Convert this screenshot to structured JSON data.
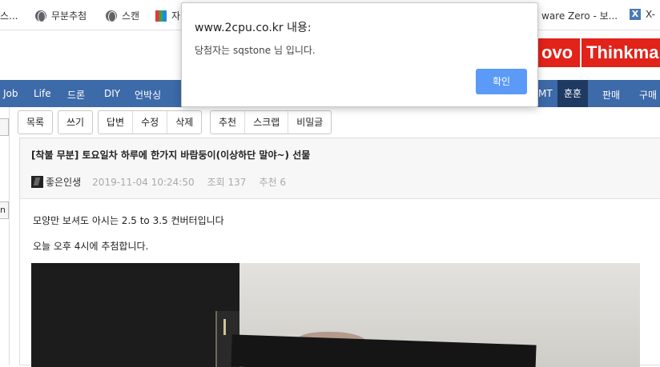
{
  "bookmarks": {
    "items": [
      {
        "label": "스..."
      },
      {
        "label": "무분추첨",
        "icon": "globe-icon"
      },
      {
        "label": "스캔",
        "icon": "globe-icon"
      },
      {
        "label": "자",
        "icon": "colorful-site-icon"
      },
      {
        "label": "ware Zero - 보...",
        "icon": ""
      },
      {
        "label": "X-",
        "icon": "x-icon"
      }
    ]
  },
  "banner": {
    "lenovo_text": "ovo",
    "thinkpad_text": "Thinkma"
  },
  "nav": {
    "items": [
      "Job",
      "Life",
      "드론",
      "DIY",
      "언박싱",
      "MT",
      "훈훈",
      "판매",
      "구매"
    ],
    "active": "훈훈"
  },
  "leftstrip": {
    "box1": "",
    "box2": "n"
  },
  "toolbar": {
    "list": "목록",
    "write": "쓰기",
    "reply": "답변",
    "edit": "수정",
    "delete": "삭제",
    "recommend": "추천",
    "scrap": "스크랩",
    "secret": "비밀글"
  },
  "post": {
    "title": "[착불 무분] 토요일차 하루에 한가지 바람둥이(이상하단 말야~) 선물",
    "author": "좋은인생",
    "datetime": "2019-11-04 10:24:50",
    "views": "조회 137",
    "recommends": "추천 6",
    "body_line1": "모양만 보셔도 아시는 2.5 to 3.5 컨버터입니다",
    "body_line2": "오늘 오후 4시에 추첨합니다."
  },
  "dialog": {
    "title": "www.2cpu.co.kr 내용:",
    "message": "당첨자는 sqstone 님 입니다.",
    "ok_label": "확인"
  },
  "colors": {
    "nav_bg": "#3d6aa8",
    "nav_active_bg": "#1e3a63",
    "lenovo_red": "#e2231a",
    "ok_button": "#5b9af7"
  }
}
